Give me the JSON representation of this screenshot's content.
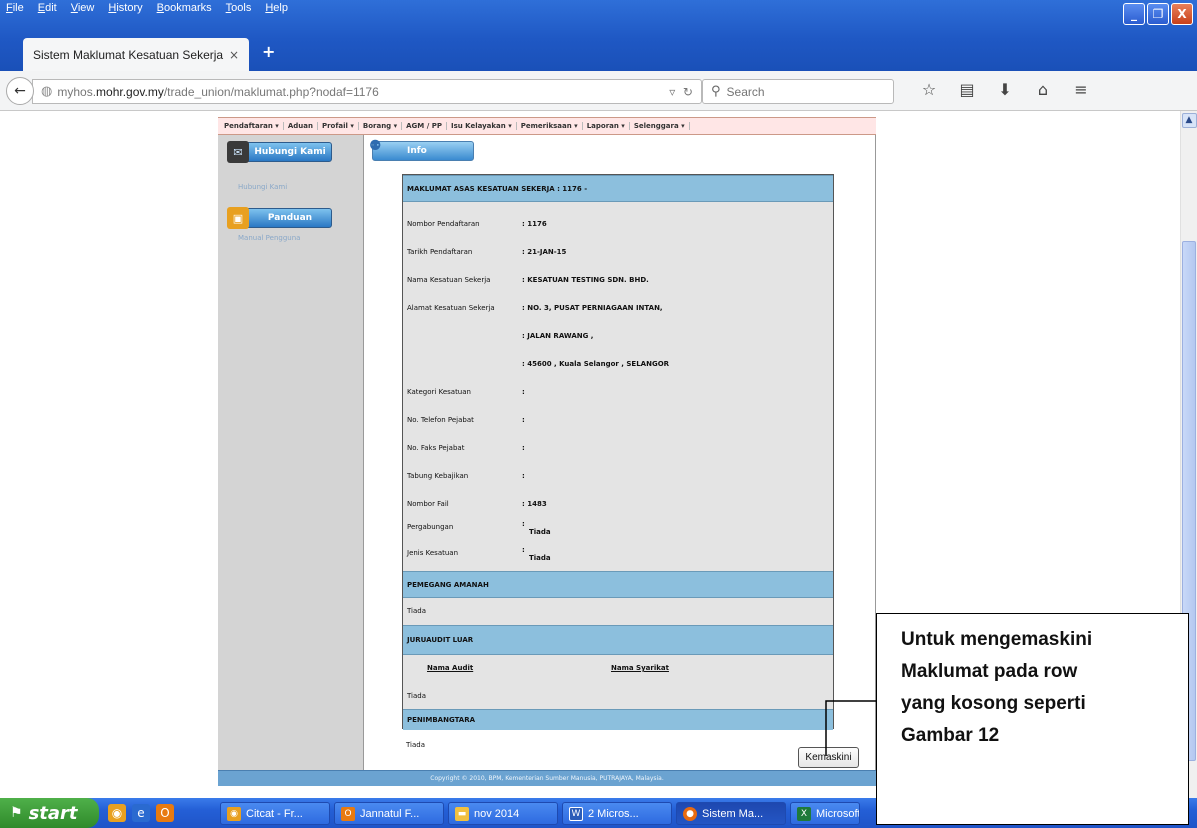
{
  "browser": {
    "menu": [
      "File",
      "Edit",
      "View",
      "History",
      "Bookmarks",
      "Tools",
      "Help"
    ],
    "tab_title": "Sistem Maklumat Kesatuan Sekerja",
    "tab_close": "×",
    "new_tab": "+",
    "url_domain_prefix": "myhos.",
    "url_domain": "mohr.gov.my",
    "url_path": "/trade_union/maklumat.php?nodaf=1176",
    "search_placeholder": "Search",
    "window_buttons": [
      "_",
      "❐",
      "X"
    ]
  },
  "page": {
    "top_nav": [
      "Pendaftaran ▾",
      "Aduan",
      "Profail ▾",
      "Borang ▾",
      "AGM / PP",
      "Isu Kelayakan ▾",
      "Pemeriksaan ▾",
      "Laporan ▾",
      "Selenggara ▾"
    ],
    "sidebar": {
      "contact_button": "Hubungi Kami",
      "contact_link": "Hubungi Kami",
      "guide_button": "Panduan",
      "guide_link": "Manual Pengguna"
    },
    "info_button": "Info",
    "section_main": "MAKLUMAT ASAS KESATUAN SEKERJA : 1176 -",
    "fields": [
      {
        "label": "Nombor Pendaftaran",
        "value": ": 1176"
      },
      {
        "label": "Tarikh Pendaftaran",
        "value": ": 21-JAN-15"
      },
      {
        "label": "Nama Kesatuan Sekerja",
        "value": ": KESATUAN TESTING SDN. BHD."
      },
      {
        "label": "Alamat Kesatuan Sekerja",
        "value": ": NO. 3, PUSAT PERNIAGAAN INTAN,"
      },
      {
        "label": "",
        "value": ": JALAN RAWANG ,"
      },
      {
        "label": "",
        "value": ": 45600 , Kuala Selangor , SELANGOR"
      },
      {
        "label": "Kategori Kesatuan",
        "value": ":"
      },
      {
        "label": "No. Telefon Pejabat",
        "value": ":"
      },
      {
        "label": "No. Faks Pejabat",
        "value": ":"
      },
      {
        "label": "Tabung Kebajikan",
        "value": ":"
      },
      {
        "label": "Nombor Fail",
        "value": ": 1483"
      },
      {
        "label": "Pergabungan",
        "value": ":",
        "value2": "Tiada"
      },
      {
        "label": "Jenis Kesatuan",
        "value": ":",
        "value2": "Tiada"
      }
    ],
    "section_trustee": "PEMEGANG AMANAH",
    "trustee_value": "Tiada",
    "section_auditor": "JURUAUDIT LUAR",
    "auditor_col1": "Nama Audit",
    "auditor_col2": "Nama Syarikat",
    "auditor_value": "Tiada",
    "section_arbiter": "PENIMBANGTARA",
    "arbiter_value": "Tiada",
    "update_button": "Kemaskini",
    "footer": "Copyright © 2010, BPM, Kementerian Sumber Manusia, PUTRAJAYA, Malaysia."
  },
  "callout": {
    "lines": [
      "Untuk mengemaskini",
      "Maklumat pada row",
      "yang kosong seperti",
      "Gambar 12"
    ]
  },
  "taskbar": {
    "start": "start",
    "tasks": [
      {
        "label": "Citcat - Fr...",
        "icon_color": "#e8a020",
        "icon": "chrome-icon"
      },
      {
        "label": "Jannatul F...",
        "icon_color": "#e87a10",
        "icon": "outlook-icon"
      },
      {
        "label": "nov 2014",
        "icon_color": "#f0c040",
        "icon": "folder-icon"
      },
      {
        "label": "2 Micros...",
        "icon_color": "#2b5cb8",
        "icon": "word-icon"
      },
      {
        "label": "Sistem Ma...",
        "icon_color": "#e86a10",
        "icon": "firefox-icon"
      },
      {
        "label": "Microsoft",
        "icon_color": "#1e7a3a",
        "icon": "excel-icon"
      }
    ]
  }
}
